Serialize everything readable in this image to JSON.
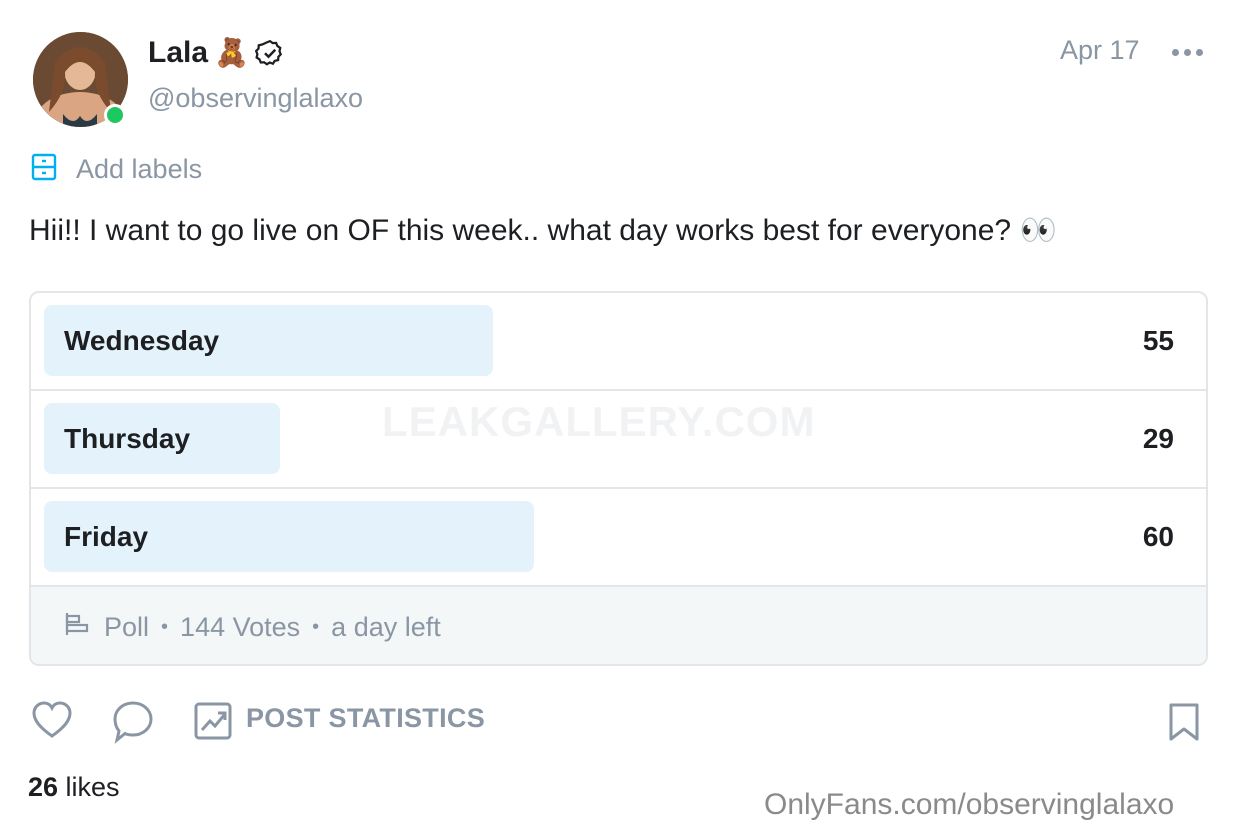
{
  "header": {
    "display_name": "Lala",
    "name_emoji": "🧸",
    "username": "@observinglalaxo",
    "date": "Apr 17"
  },
  "labels": {
    "text": "Add labels"
  },
  "post": {
    "text": "Hii!! I want to go live on OF this week.. what day works best for everyone? 👀"
  },
  "poll": {
    "options": [
      {
        "label": "Wednesday",
        "votes": "55",
        "fill_fraction": 0.382
      },
      {
        "label": "Thursday",
        "votes": "29",
        "fill_fraction": 0.201
      },
      {
        "label": "Friday",
        "votes": "60",
        "fill_fraction": 0.417
      }
    ],
    "footer": {
      "type": "Poll",
      "votes": "144 Votes",
      "time_left": "a day left"
    }
  },
  "watermark_center": "LEAKGALLERY.COM",
  "actions": {
    "stats_label": "POST STATISTICS"
  },
  "likes": {
    "count": "26",
    "suffix": " likes"
  },
  "watermark_bottom": "OnlyFans.com/observinglalaxo",
  "colors": {
    "muted": "#8a96a3",
    "poll_bar": "#e4f3fb",
    "online": "#1ec75f",
    "accent": "#00aff0"
  },
  "icons": [
    "verified-icon",
    "more-icon",
    "labels-icon",
    "poll-icon",
    "heart-icon",
    "comment-icon",
    "stats-icon",
    "bookmark-icon"
  ]
}
